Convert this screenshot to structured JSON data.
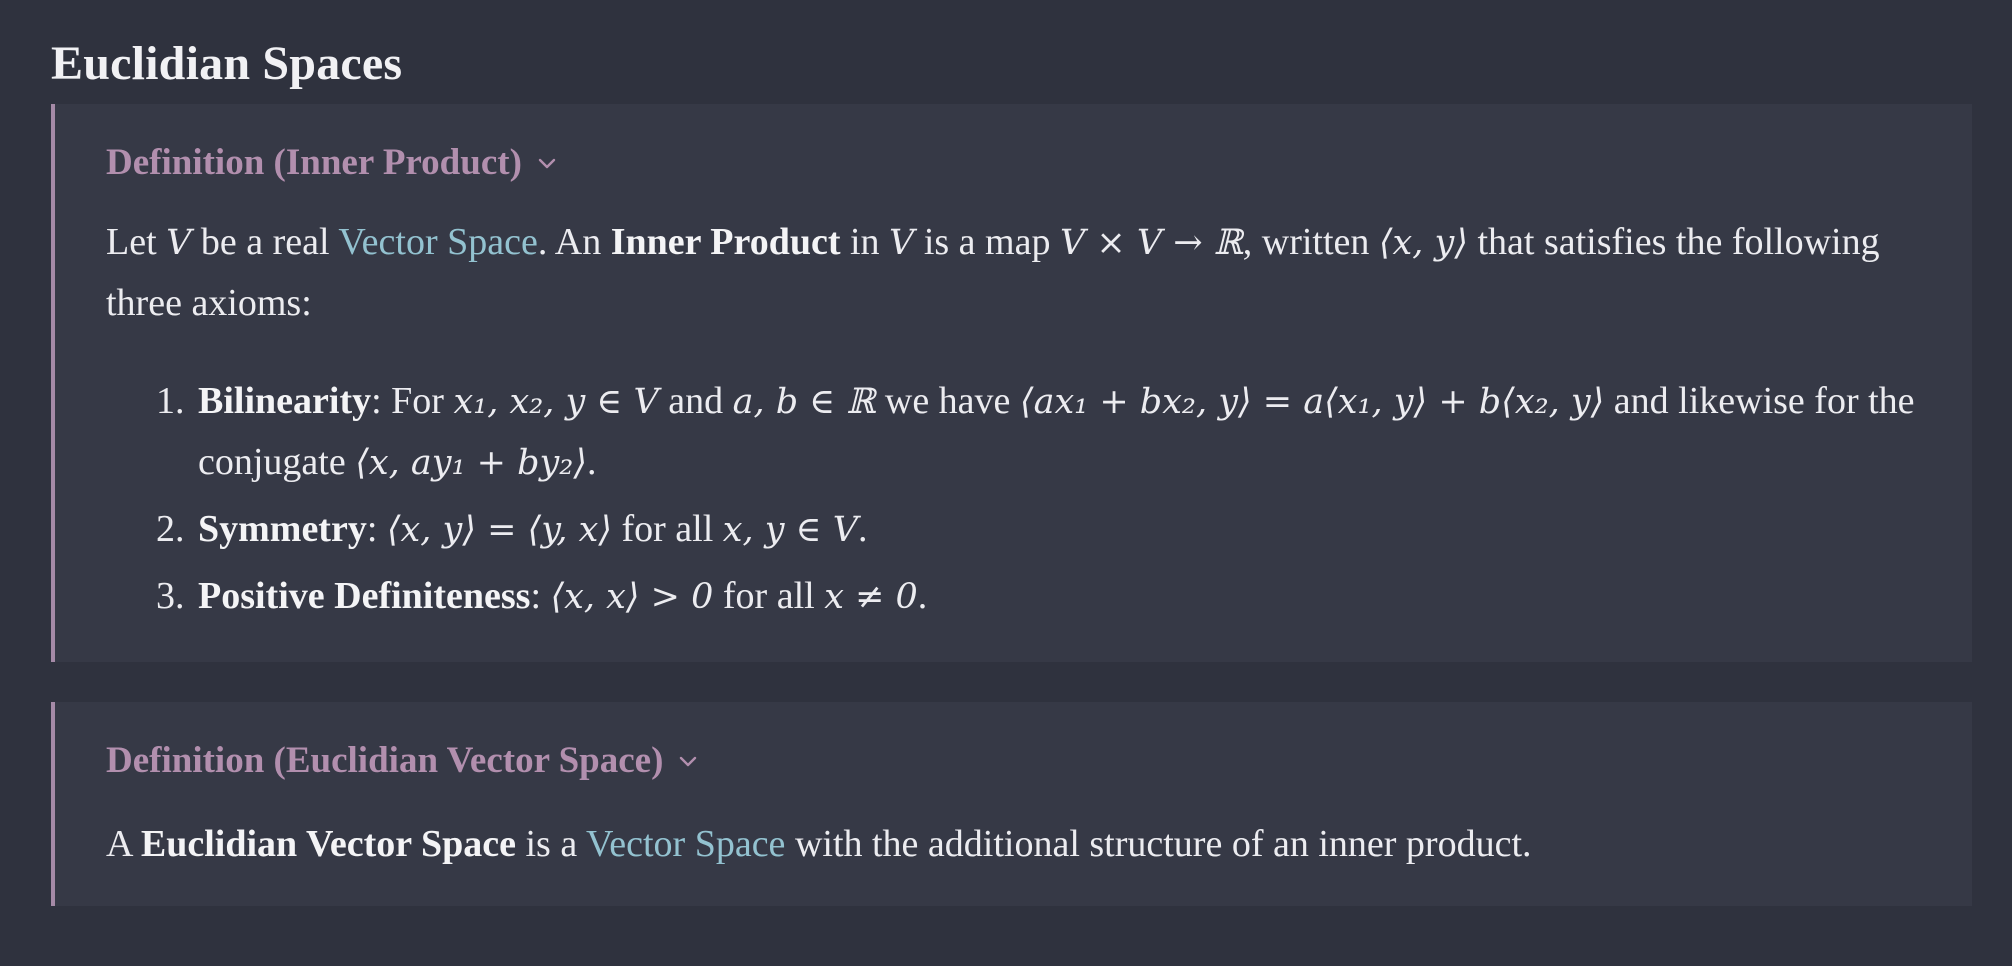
{
  "page": {
    "title": "Euclidian Spaces"
  },
  "def1": {
    "title": "Definition (Inner Product)",
    "collapse_icon": "chevron-down-icon",
    "intro": {
      "t1": "Let ",
      "v1": "V",
      "t2": " be a real ",
      "link": "Vector Space",
      "t3": ". An ",
      "bold": "Inner Product",
      "t4": " in ",
      "v2": "V",
      "t5": " is a map ",
      "map": "V × V → ℝ",
      "t6": ", written ",
      "ip": "⟨x, y⟩",
      "t7": " that satisfies the following three axioms:"
    },
    "axioms": [
      {
        "name": "Bilinearity",
        "a1": ": For ",
        "m1": "x₁, x₂, y ∈ V",
        "a2": " and ",
        "m2": "a, b ∈ ℝ",
        "a3": " we have ",
        "m3": "⟨ax₁ + bx₂, y⟩ = a⟨x₁, y⟩ + b⟨x₂, y⟩",
        "a4": " and likewise for the conjugate ",
        "m4": "⟨x, ay₁ + by₂⟩",
        "a5": "."
      },
      {
        "name": "Symmetry",
        "a1": ": ",
        "m1": "⟨x, y⟩ = ⟨y, x⟩",
        "a2": " for all ",
        "m2": "x, y ∈ V",
        "a3": "."
      },
      {
        "name": "Positive Definiteness",
        "a1": ": ",
        "m1": "⟨x, x⟩ > 0",
        "a2": " for all ",
        "m2": "x ≠ 0",
        "a3": "."
      }
    ]
  },
  "def2": {
    "title": "Definition (Euclidian Vector Space)",
    "collapse_icon": "chevron-down-icon",
    "t1": "A ",
    "bold": "Euclidian Vector Space",
    "t2": " is a ",
    "link": "Vector Space",
    "t3": " with the additional structure of an inner product."
  },
  "colors": {
    "background": "#2f323e",
    "callout_bg": "#363946",
    "callout_border": "#a58aa7",
    "callout_title": "#b28fae",
    "link": "#93c2d0"
  }
}
